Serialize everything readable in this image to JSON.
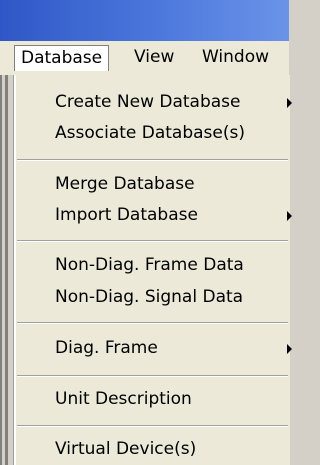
{
  "menubar": {
    "items": [
      {
        "label": "Database"
      },
      {
        "label": "View"
      },
      {
        "label": "Window"
      }
    ]
  },
  "dropdown": {
    "items": [
      {
        "label": "Create New Database",
        "submenu": true
      },
      {
        "label": "Associate Database(s)",
        "submenu": false
      },
      {
        "label": "Merge Database",
        "submenu": false
      },
      {
        "label": "Import Database",
        "submenu": true
      },
      {
        "label": "Non-Diag. Frame Data",
        "submenu": false
      },
      {
        "label": "Non-Diag. Signal Data",
        "submenu": false
      },
      {
        "label": "Diag. Frame",
        "submenu": true
      },
      {
        "label": "Unit Description",
        "submenu": false
      },
      {
        "label": "Virtual Device(s)",
        "submenu": false
      }
    ]
  }
}
